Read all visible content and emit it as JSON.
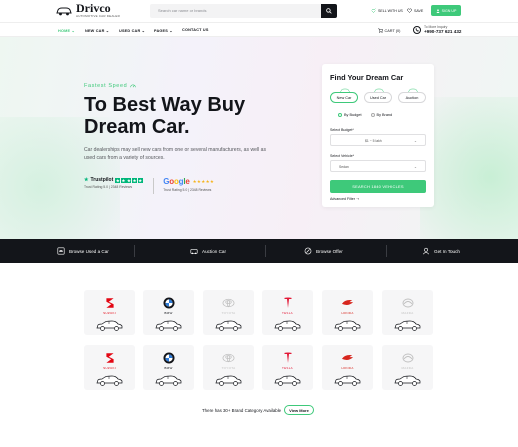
{
  "header": {
    "logo_name": "Drivco",
    "logo_tagline": "AUTOMOTIVE CAR DEALER",
    "search_placeholder": "Search car name or brands",
    "sell_label": "SELL WITH US",
    "save_label": "SAVE",
    "signup_label": "SIGN UP"
  },
  "nav": {
    "items": [
      {
        "label": "HOME ⌄"
      },
      {
        "label": "NEW CAR ⌄"
      },
      {
        "label": "USED CAR ⌄"
      },
      {
        "label": "PAGES ⌄"
      },
      {
        "label": "CONTACT US"
      }
    ],
    "cart_label": "CART (0)",
    "phone_label": "To More Inquiry",
    "phone_number": "+990-737 621 432"
  },
  "hero": {
    "eyebrow": "Fastest Speed",
    "headline": "To Best Way Buy Dream Car.",
    "subtext": "Car dealerships may sell new cars from one or several manufacturers, as well as used cars from a variety of sources.",
    "trustpilot": {
      "name": "Trustpilot",
      "rating_text": "Trust Rating 5.0 | 2348 Reviews"
    },
    "google": {
      "name": "Google",
      "rating_text": "Trust Rating 5.0 | 2348 Reviews"
    }
  },
  "finder": {
    "title": "Find Your Dream Car",
    "tabs": [
      {
        "label": "New Car"
      },
      {
        "label": "Used Car"
      },
      {
        "label": "Auction"
      }
    ],
    "radios": [
      {
        "label": "By Budget"
      },
      {
        "label": "By Brand"
      }
    ],
    "budget_label": "Select Budget*",
    "budget_value": "$1 ~ 5 lakh",
    "vehicle_label": "Select Vehicle*",
    "vehicle_value": "Sedan",
    "search_label": "SEARCH 1840 VEHICLES",
    "advanced_label": "Advanced Filter ⇢"
  },
  "band": {
    "items": [
      {
        "label": "Browse Used a Car",
        "icon": "browse-car-icon"
      },
      {
        "label": "Auction Car",
        "icon": "auction-icon"
      },
      {
        "label": "Browse Offer",
        "icon": "offer-icon"
      },
      {
        "label": "Get In Touch",
        "icon": "contact-icon"
      }
    ]
  },
  "brands": {
    "row1": [
      {
        "name": "SUZUKI"
      },
      {
        "name": "BMW"
      },
      {
        "name": "TOYOTA"
      },
      {
        "name": "TESLA"
      },
      {
        "name": "HONDA"
      },
      {
        "name": "MAZDA"
      }
    ],
    "row2": [
      {
        "name": "SUZUKI"
      },
      {
        "name": "BMW"
      },
      {
        "name": "TOYOTA"
      },
      {
        "name": "TESLA"
      },
      {
        "name": "HONDA"
      },
      {
        "name": "MAZDA"
      }
    ],
    "footer_text": "There has 30+ Brand Category Available",
    "view_more": "View More"
  },
  "colors": {
    "accent": "#3ec97a",
    "dark": "#13151a",
    "suzuki": "#e30613",
    "tesla": "#e31937",
    "honda": "#d7261e"
  }
}
